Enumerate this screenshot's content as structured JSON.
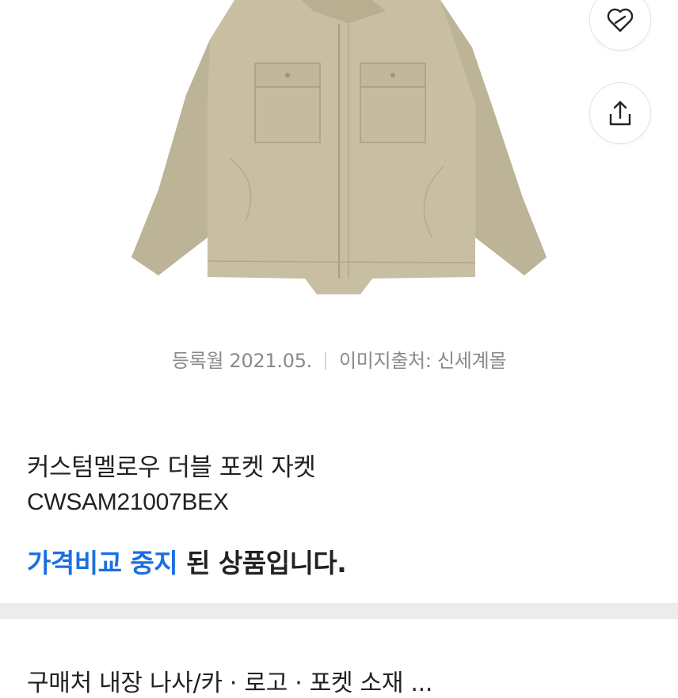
{
  "product": {
    "meta": {
      "registered": "등록월 2021.05.",
      "image_source": "이미지출처: 신세계몰"
    },
    "name": "커스텀멜로우 더블 포켓 자켓",
    "code": "CWSAM21007BEX",
    "notice": {
      "highlight": "가격비교 중지",
      "rest": " 된 상품입니다."
    }
  },
  "actions": {
    "favorite_icon": "heart-link-icon",
    "share_icon": "share-icon"
  },
  "cutoff_text": "구매처 내장 나사/카 · 로고 · 포켓 소재 ...",
  "colors": {
    "accent": "#1a6fe0",
    "jacket": "#c8bea2",
    "divider": "#ececec"
  }
}
